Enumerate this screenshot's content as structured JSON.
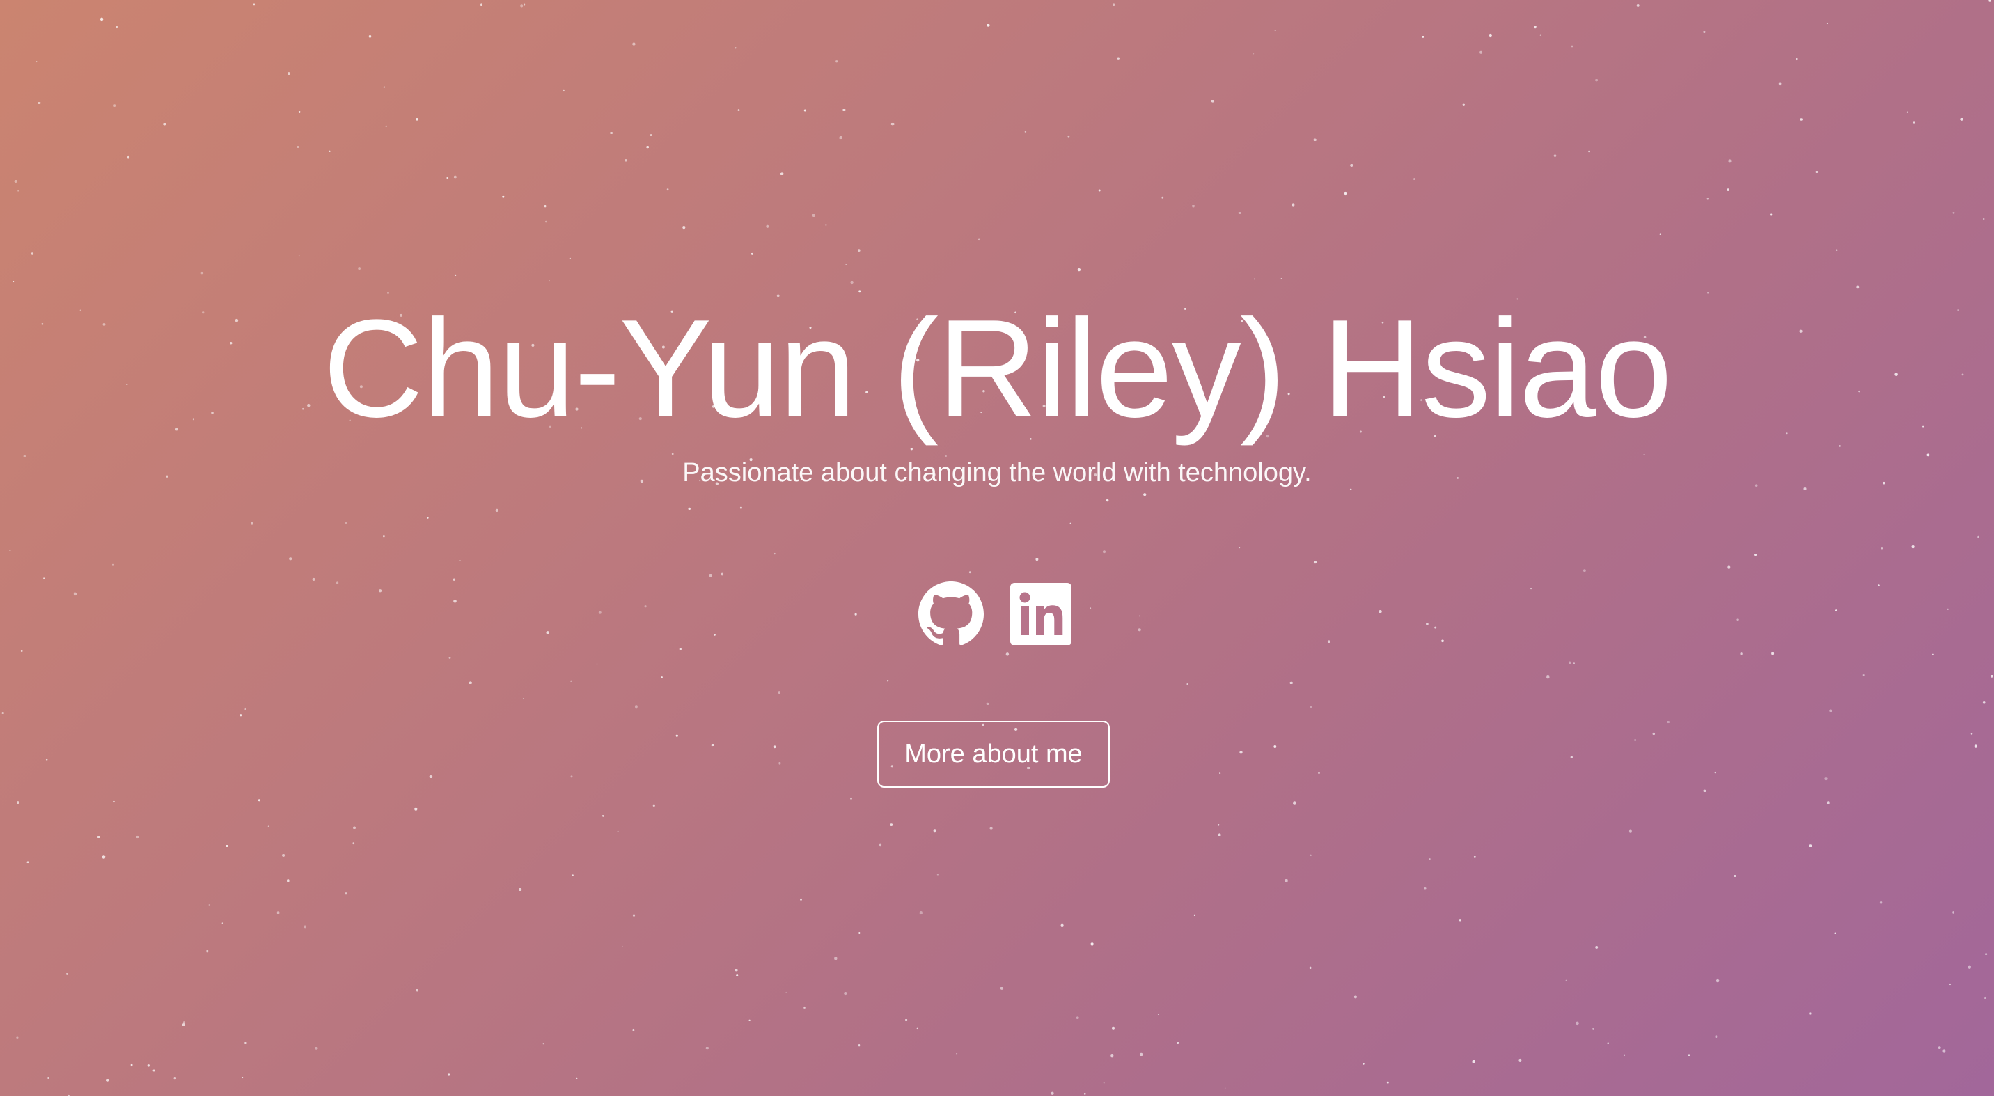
{
  "hero": {
    "title": "Chu-Yun (Riley) Hsiao",
    "subtitle": "Passionate about changing the world with technology.",
    "cta_label": "More about me",
    "background": {
      "gradient_start": "#cb8470",
      "gradient_end": "#a2679a"
    }
  },
  "social_links": [
    {
      "icon": "github-icon"
    },
    {
      "icon": "linkedin-icon"
    }
  ]
}
